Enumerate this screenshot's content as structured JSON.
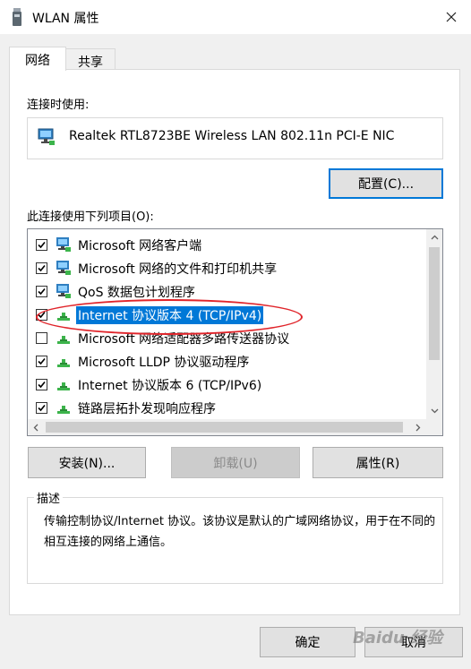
{
  "window": {
    "title": "WLAN 属性"
  },
  "tabs": [
    {
      "label": "网络",
      "active": true
    },
    {
      "label": "共享",
      "active": false
    }
  ],
  "connect_using": {
    "label": "连接时使用:",
    "adapter": "Realtek RTL8723BE Wireless LAN 802.11n PCI-E NIC",
    "configure_button": "配置(C)..."
  },
  "items_section": {
    "label": "此连接使用下列项目(O):",
    "items": [
      {
        "label": "Microsoft 网络客户端",
        "checked": true,
        "icon": "network-client-icon"
      },
      {
        "label": "Microsoft 网络的文件和打印机共享",
        "checked": true,
        "icon": "network-client-icon"
      },
      {
        "label": "QoS 数据包计划程序",
        "checked": true,
        "icon": "network-client-icon"
      },
      {
        "label": "Internet 协议版本 4 (TCP/IPv4)",
        "checked": true,
        "icon": "protocol-icon",
        "selected": true
      },
      {
        "label": "Microsoft 网络适配器多路传送器协议",
        "checked": false,
        "icon": "protocol-icon"
      },
      {
        "label": "Microsoft LLDP 协议驱动程序",
        "checked": true,
        "icon": "protocol-icon"
      },
      {
        "label": "Internet 协议版本 6 (TCP/IPv6)",
        "checked": true,
        "icon": "protocol-icon"
      },
      {
        "label": "链路层拓扑发现响应程序",
        "checked": true,
        "icon": "protocol-icon"
      }
    ]
  },
  "action_buttons": {
    "install": "安装(N)...",
    "uninstall": "卸载(U)",
    "properties": "属性(R)"
  },
  "description": {
    "legend": "描述",
    "text": "传输控制协议/Internet 协议。该协议是默认的广域网络协议，用于在不同的相互连接的网络上通信。"
  },
  "footer": {
    "ok": "确定",
    "cancel": "取消"
  },
  "watermark": "Baidu 经验",
  "colors": {
    "accent": "#0078d7",
    "annotation": "#e0242a",
    "dialog_bg": "#f0f0f0"
  }
}
